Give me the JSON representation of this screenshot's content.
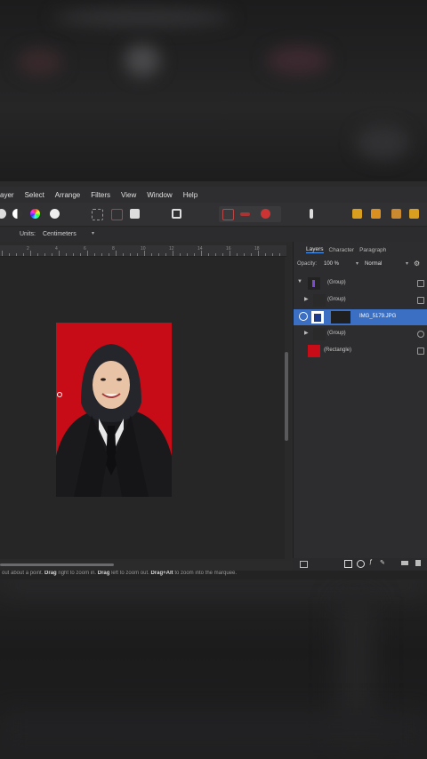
{
  "menu": {
    "items": [
      "ayer",
      "Select",
      "Arrange",
      "Filters",
      "View",
      "Window",
      "Help"
    ]
  },
  "context_toolbar": {
    "units_label": "Units:",
    "units_value": "Centimeters"
  },
  "panel": {
    "tabs": [
      "Layers",
      "Character",
      "Paragraph"
    ],
    "active_tab": "Layers",
    "opacity_label": "Opacity:",
    "opacity_value": "100 %",
    "blend_mode": "Normal",
    "layers": [
      {
        "name": "(Group)",
        "selected": false,
        "expanded": true
      },
      {
        "name": "(Group)",
        "selected": false,
        "expanded": false
      },
      {
        "name": "IMG_5179.JPG",
        "selected": true,
        "expanded": false
      },
      {
        "name": "(Group)",
        "selected": false,
        "expanded": false
      },
      {
        "name": "(Rectangle)",
        "selected": false,
        "expanded": false
      }
    ]
  },
  "status": {
    "pre1": "out about a point.",
    "b1": "Drag",
    "mid1": "right to zoom in.",
    "b2": "Drag",
    "mid2": "left to zoom out.",
    "b3": "Drag+Alt",
    "post": "to zoom into the marquee."
  },
  "ruler_numbers": [
    "2",
    "4",
    "6",
    "8",
    "10",
    "12",
    "14",
    "16",
    "18"
  ],
  "colors": {
    "accent": "#3a7bd5",
    "photo_background": "#c80c17",
    "selected_layer": "#3a6fc4"
  }
}
